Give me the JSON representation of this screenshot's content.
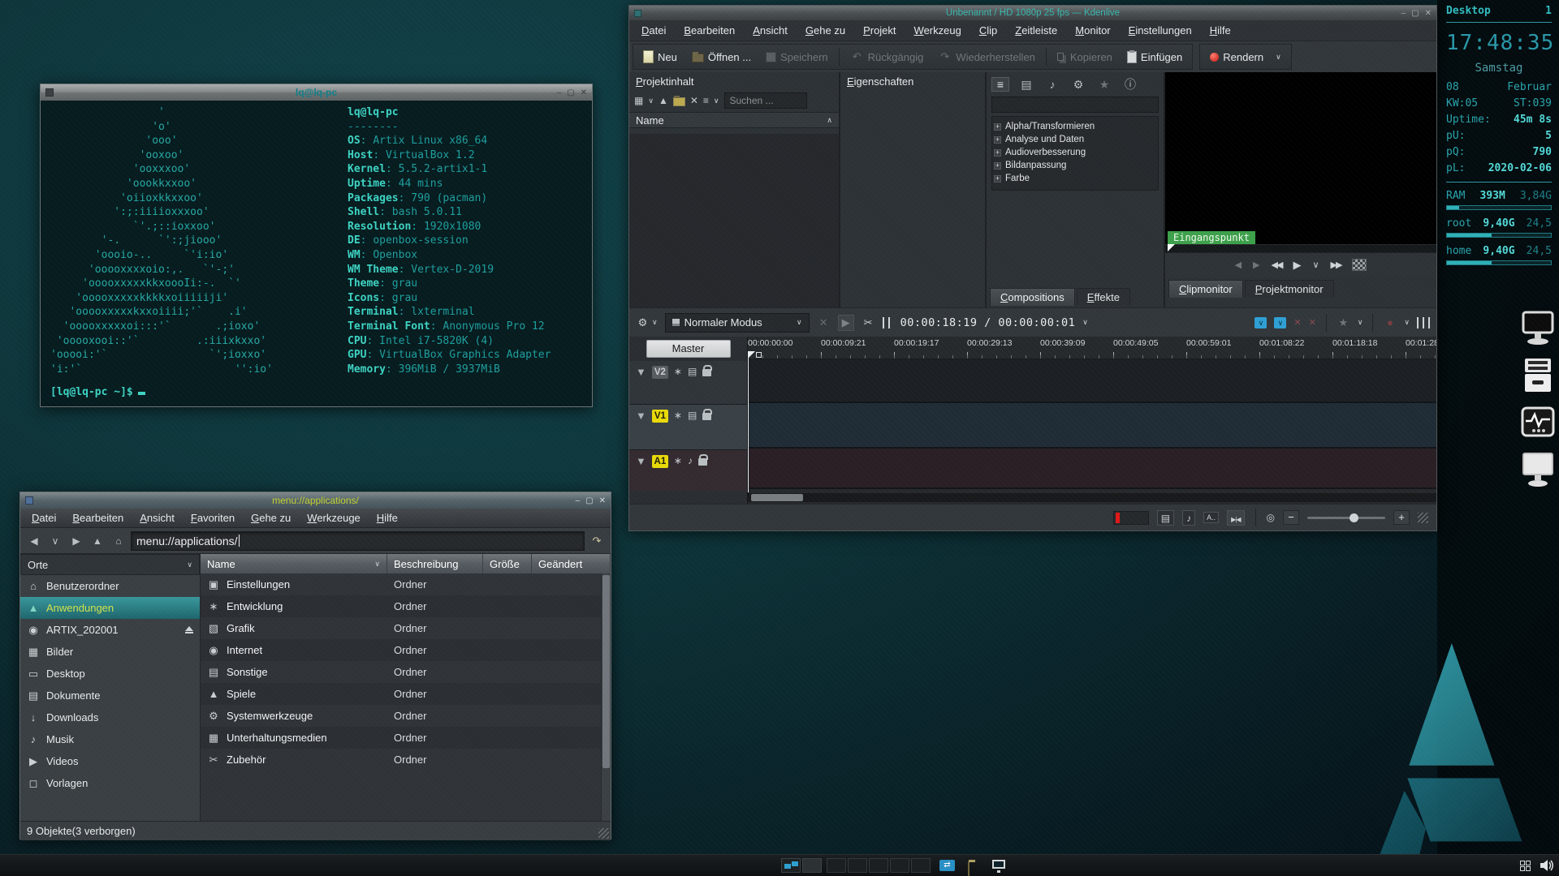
{
  "glyphs": {
    "minimize": "–",
    "maximize": "▢",
    "close": "✕",
    "chevron_down": "∨",
    "chevron_up": "∧",
    "back": "◀",
    "forward": "▶",
    "up_arrow": "▲",
    "down_arrow": "▼",
    "home": "⌂",
    "jump": "↷",
    "menu": "≡",
    "add_clip": "▦",
    "delete": "✕",
    "note": "♪",
    "film": "▤",
    "star": "★",
    "info": "ⓘ",
    "gear": "⚙",
    "undo": "↶",
    "redo": "↷",
    "play": "▶",
    "rew": "◀◀",
    "ffwd": "▶▶",
    "scissors": "✂",
    "fx": "∗",
    "target": "◎",
    "minus": "−",
    "plus": "+",
    "record": "●",
    "x_mark": "✕",
    "skip_start": "◀",
    "skip_end": "▶",
    "transfer": "⇄"
  },
  "terminal": {
    "title": "lq@lq-pc",
    "ascii_art": "                 '\n                'o'\n               'ooo'\n              'ooxoo'\n             'ooxxxoo'\n            'oookkxxoo'\n           'oiioxkkxxoo'\n          ':;:iiiioxxxoo'\n             `'.;::ioxxoo'\n        '-.      `':;jiooo'\n       'oooio-..     `'i:io'\n      'ooooxxxxoio:,.   `'-;'\n     'ooooxxxxxkkxoooIi:-.  `'\n    'ooooxxxxxkkkkxoiiiiiji'\n   'ooooxxxxxkxxoiiii;'`    .i'\n  'ooooxxxxxoi:::'`       .;ioxo'\n 'ooooxooi::'`         .:iiixkxxo'\n'ooooi:'`                `';ioxxo'\n'i:'`                        '':io'",
    "user_host": "lq@lq-pc",
    "underline": "--------",
    "info": [
      {
        "label": "OS",
        "value": "Artix Linux x86_64"
      },
      {
        "label": "Host",
        "value": "VirtualBox 1.2"
      },
      {
        "label": "Kernel",
        "value": "5.5.2-artix1-1"
      },
      {
        "label": "Uptime",
        "value": "44 mins"
      },
      {
        "label": "Packages",
        "value": "790 (pacman)"
      },
      {
        "label": "Shell",
        "value": "bash 5.0.11"
      },
      {
        "label": "Resolution",
        "value": "1920x1080"
      },
      {
        "label": "DE",
        "value": "openbox-session"
      },
      {
        "label": "WM",
        "value": "Openbox"
      },
      {
        "label": "WM Theme",
        "value": "Vertex-D-2019"
      },
      {
        "label": "Theme",
        "value": "grau"
      },
      {
        "label": "Icons",
        "value": "grau"
      },
      {
        "label": "Terminal",
        "value": "lxterminal"
      },
      {
        "label": "Terminal Font",
        "value": "Anonymous Pro 12"
      },
      {
        "label": "CPU",
        "value": "Intel i7-5820K (4)"
      },
      {
        "label": "GPU",
        "value": "VirtualBox Graphics Adapter"
      },
      {
        "label": "Memory",
        "value": "396MiB / 3937MiB"
      }
    ],
    "prompt": "[lq@lq-pc ~]$"
  },
  "file_manager": {
    "title": "menu://applications/",
    "menus": [
      "Datei",
      "Bearbeiten",
      "Ansicht",
      "Favoriten",
      "Gehe zu",
      "Werkzeuge",
      "Hilfe"
    ],
    "address": "menu://applications/",
    "sidebar": {
      "header": "Orte",
      "items": [
        {
          "label": "Benutzerordner",
          "glyph": "⌂"
        },
        {
          "label": "Anwendungen",
          "glyph": "▲"
        },
        {
          "label": "ARTIX_202001",
          "glyph": "◉"
        },
        {
          "label": "Bilder",
          "glyph": "▦"
        },
        {
          "label": "Desktop",
          "glyph": "▭"
        },
        {
          "label": "Dokumente",
          "glyph": "▤"
        },
        {
          "label": "Downloads",
          "glyph": "↓"
        },
        {
          "label": "Musik",
          "glyph": "♪"
        },
        {
          "label": "Videos",
          "glyph": "▶"
        },
        {
          "label": "Vorlagen",
          "glyph": "◻"
        }
      ]
    },
    "columns": {
      "name": "Name",
      "description": "Beschreibung",
      "size": "Größe",
      "modified": "Geändert"
    },
    "rows": [
      {
        "name": "Einstellungen",
        "glyph": "▣",
        "description": "Ordner"
      },
      {
        "name": "Entwicklung",
        "glyph": "∗",
        "description": "Ordner"
      },
      {
        "name": "Grafik",
        "glyph": "▧",
        "description": "Ordner"
      },
      {
        "name": "Internet",
        "glyph": "◉",
        "description": "Ordner"
      },
      {
        "name": "Sonstige",
        "glyph": "▤",
        "description": "Ordner"
      },
      {
        "name": "Spiele",
        "glyph": "▲",
        "description": "Ordner"
      },
      {
        "name": "Systemwerkzeuge",
        "glyph": "⚙",
        "description": "Ordner"
      },
      {
        "name": "Unterhaltungsmedien",
        "glyph": "▦",
        "description": "Ordner"
      },
      {
        "name": "Zubehör",
        "glyph": "✂",
        "description": "Ordner"
      }
    ],
    "status": "9 Objekte(3 verborgen)"
  },
  "kdenlive": {
    "title": "Unbenannt / HD 1080p 25 fps — Kdenlive",
    "menus": [
      "Datei",
      "Bearbeiten",
      "Ansicht",
      "Gehe zu",
      "Projekt",
      "Werkzeug",
      "Clip",
      "Zeitleiste",
      "Monitor",
      "Einstellungen",
      "Hilfe"
    ],
    "toolbar": [
      {
        "label": "Neu"
      },
      {
        "label": "Öffnen ..."
      },
      {
        "label": "Speichern"
      },
      {
        "label": "Rückgängig"
      },
      {
        "label": "Wiederherstellen"
      },
      {
        "label": "Kopieren"
      },
      {
        "label": "Einfügen"
      }
    ],
    "render_label": "Rendern",
    "project_panel": {
      "title": "Projektinhalt",
      "search_placeholder": "Suchen ...",
      "column": "Name"
    },
    "properties_title": "Eigenschaften",
    "effects_panel": {
      "categories": [
        "Alpha/Transformieren",
        "Analyse und Daten",
        "Audioverbesserung",
        "Bildanpassung",
        "Farbe"
      ],
      "tabs": [
        "Compositions",
        "Effekte"
      ]
    },
    "monitor": {
      "zone_label": "Eingangspunkt",
      "tabs": [
        "Clipmonitor",
        "Projektmonitor"
      ]
    },
    "timeline_toolbar": {
      "mode": "Normaler Modus",
      "timecode_display": "00:00:18:19 / 00:00:00:01"
    },
    "timeline": {
      "master": "Master",
      "ruler": [
        "00:00:00:00",
        "00:00:09:21",
        "00:00:19:17",
        "00:00:29:13",
        "00:00:39:09",
        "00:00:49:05",
        "00:00:59:01",
        "00:01:08:22",
        "00:01:18:18",
        "00:01:28:"
      ],
      "tracks": [
        {
          "id": "V2",
          "kind": "video"
        },
        {
          "id": "V1",
          "kind": "video"
        },
        {
          "id": "A1",
          "kind": "audio"
        }
      ]
    },
    "statusbar": {
      "subtitle_icon": "A.."
    }
  },
  "conky": {
    "header_left": "Desktop",
    "header_right": "1",
    "clock": "17:48:35",
    "day": "Samstag",
    "rows": [
      {
        "left": "08",
        "right": "Februar"
      },
      {
        "left": "KW:05",
        "right": "ST:039"
      },
      {
        "left": "Uptime:",
        "right": "45m 8s"
      },
      {
        "left": "pU:",
        "right": "5"
      },
      {
        "left": "pQ:",
        "right": "790"
      },
      {
        "left": "pL:",
        "right": "2020-02-06"
      }
    ],
    "meters": [
      {
        "label": "RAM",
        "used": "393M",
        "total": "3,84G",
        "pct": 12
      },
      {
        "label": "root",
        "used": "9,40G",
        "total": "24,5",
        "pct": 43
      },
      {
        "label": "home",
        "used": "9,40G",
        "total": "24,5",
        "pct": 43
      }
    ]
  }
}
